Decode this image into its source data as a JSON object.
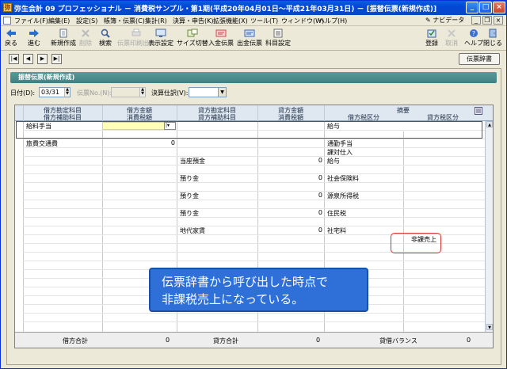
{
  "window": {
    "title": "弥生会計 09 プロフェッショナル － 消費税サンプル・第1期(平成20年04月01日～平成21年03月31日) － [振替伝票(新規作成)]",
    "icon_char": "弥"
  },
  "menu": {
    "items": [
      "ファイル(F)",
      "編集(E)",
      "設定(S)",
      "帳簿・伝票(C)",
      "集計(R)",
      "決算・申告(K)",
      "拡張機能(X)",
      "ツール(T)",
      "ウィンドウ(W)",
      "ヘルプ(H)"
    ],
    "navi": "ナビデータ"
  },
  "toolbar": {
    "back": "戻る",
    "forward": "進む",
    "new": "新規作成",
    "delete": "削除",
    "search": "検索",
    "slip_output": "伝票印刷出力",
    "display_settings": "表示設定",
    "size_switch": "サイズ切替",
    "receipt_slip": "入金伝票",
    "payment_slip": "出金伝票",
    "account_settings": "科目設定",
    "register": "登録",
    "cancel": "取消",
    "help": "ヘルプ",
    "close": "閉じる"
  },
  "nav": {
    "first": "|◀",
    "prev": "◀",
    "next": "▶",
    "last": "▶|",
    "dictionary_button": "伝票辞書"
  },
  "panel": {
    "title": "振替伝票(新規作成)"
  },
  "form": {
    "date_label": "日付(D):",
    "date_value": "03/31",
    "slip_no_label": "伝票No.(N):",
    "slip_no_value": "",
    "closing_label": "決算仕訳(V):",
    "closing_value": ""
  },
  "grid": {
    "headers_row1": [
      "借方勘定科目",
      "借方金額",
      "貸方勘定科目",
      "貸方金額",
      "摘要"
    ],
    "headers_row2": [
      "借方補助科目",
      "消費税額",
      "貸方補助科目",
      "消費税額",
      "借方税区分",
      "貸方税区分"
    ],
    "rows": [
      {
        "debit_account": "給料手当",
        "debit_amount": "",
        "credit_account": "",
        "credit_amount": "",
        "memo": "給与"
      },
      {
        "debit_account": "旅費交通費",
        "debit_amount": "0",
        "credit_account": "",
        "credit_amount": "",
        "memo": "通勤手当",
        "debit_tax": "課対仕入"
      },
      {
        "debit_account": "",
        "debit_amount": "",
        "credit_account": "当座預金",
        "credit_amount": "0",
        "memo": "給与"
      },
      {
        "debit_account": "",
        "debit_amount": "",
        "credit_account": "預り金",
        "credit_amount": "0",
        "memo": "社会保険料"
      },
      {
        "debit_account": "",
        "debit_amount": "",
        "credit_account": "預り金",
        "credit_amount": "0",
        "memo": "源泉所得税"
      },
      {
        "debit_account": "",
        "debit_amount": "",
        "credit_account": "預り金",
        "credit_amount": "0",
        "memo": "住民税"
      },
      {
        "debit_account": "",
        "debit_amount": "",
        "credit_account": "地代家賃",
        "credit_amount": "0",
        "memo": "社宅料",
        "credit_tax": "非課売上"
      }
    ],
    "footer": {
      "debit_total_label": "借方合計",
      "debit_total": "0",
      "credit_total_label": "貸方合計",
      "credit_total": "0",
      "balance_label": "貸借バランス",
      "balance": "0"
    }
  },
  "annotation": {
    "line1": "伝票辞書から呼び出した時点で",
    "line2": "非課税売上になっている。"
  },
  "colors": {
    "title_bar": "#0a5fe0",
    "panel_title": "#4a8a8c",
    "annotation_bg": "#2f6fd8",
    "highlight": "#d43030",
    "edit_cell": "#ffffb8"
  }
}
